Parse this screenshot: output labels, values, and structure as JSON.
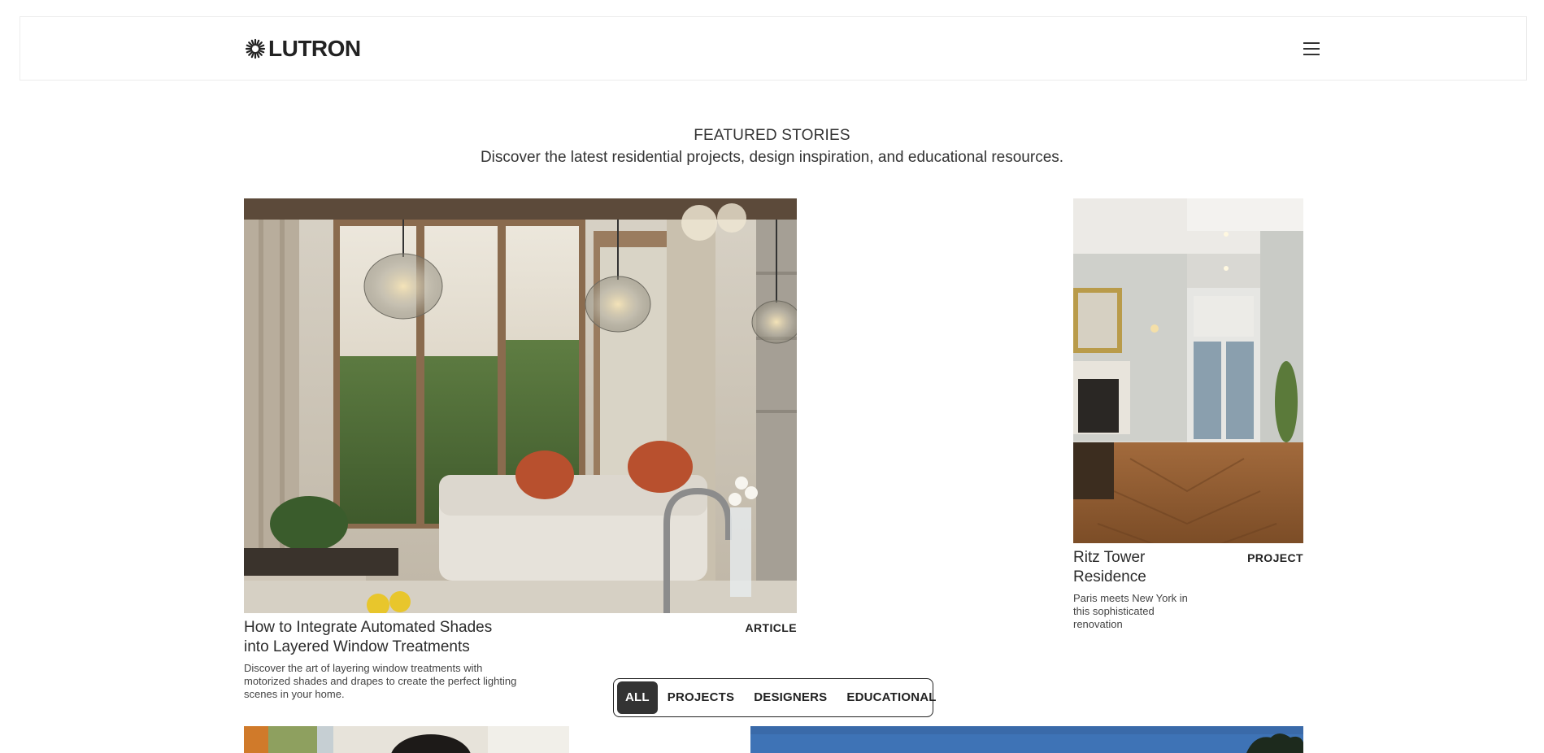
{
  "brand": {
    "name": "LUTRON"
  },
  "header": {
    "menu_icon": "hamburger-menu-icon"
  },
  "intro": {
    "title": "FEATURED STORIES",
    "subtitle": "Discover the latest residential projects, design inspiration, and educational resources."
  },
  "cards": [
    {
      "title_line1": "How to Integrate Automated Shades",
      "title_line2": "into Layered Window Treatments",
      "desc_line1": "Discover the art of layering window treatments with",
      "desc_line2": "motorized shades and drapes to create the perfect lighting",
      "desc_line3": "scenes in your home.",
      "type": "ARTICLE"
    },
    {
      "title_line1": "Ritz Tower",
      "title_line2": "Residence",
      "desc_line1": "Paris meets New York in",
      "desc_line2": "this sophisticated",
      "desc_line3": "renovation",
      "type": "PROJECT"
    }
  ],
  "filters": {
    "items": [
      "ALL",
      "PROJECTS",
      "DESIGNERS",
      "EDUCATIONAL"
    ],
    "selected": "ALL"
  },
  "colors": {
    "accent": "#333333",
    "border": "#ececec",
    "text": "#2b2b2b"
  }
}
